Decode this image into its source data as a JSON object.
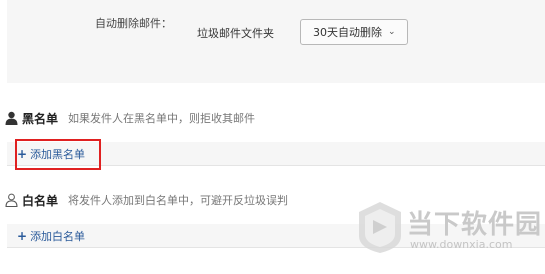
{
  "spam_settings": {
    "auto_delete_label": "自动删除邮件：",
    "folder_label": "垃圾邮件文件夹",
    "dropdown_value": "30天自动删除"
  },
  "blacklist": {
    "title": "黑名单",
    "description": "如果发件人在黑名单中，则拒收其邮件",
    "add_label": "添加黑名单"
  },
  "whitelist": {
    "title": "白名单",
    "description": "将发件人添加到白名单中，可避开反垃圾误判",
    "add_label": "添加白名单"
  },
  "watermark": {
    "name": "当下软件园",
    "url": "www.downxia.com"
  },
  "colors": {
    "link": "#2a5a9a",
    "highlight": "#e02020",
    "panel": "#f6f6f6"
  }
}
